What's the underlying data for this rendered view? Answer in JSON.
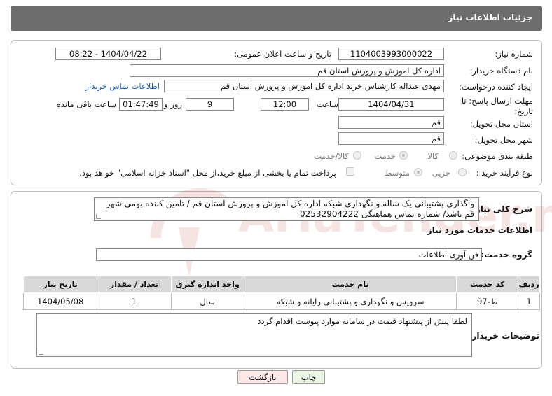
{
  "header": {
    "title": "جزئیات اطلاعات نیاز"
  },
  "form": {
    "need_number_label": "شماره نیاز:",
    "need_number": "1104003993000022",
    "announce_label": "تاریخ و ساعت اعلان عمومی:",
    "announce_value": "1404/04/22 - 08:22",
    "buyer_org_label": "نام دستگاه خریدار:",
    "buyer_org": "اداره کل اموزش و پرورش استان قم",
    "creator_label": "ایجاد کننده درخواست:",
    "creator": "مهدی عیداله کارشناس خرید اداره کل اموزش و پرورش استان قم",
    "contact_link": "اطلاعات تماس خریدار",
    "deadline_label_1": "مهلت ارسال پاسخ: تا",
    "deadline_label_2": "تاریخ:",
    "deadline_date": "1404/04/31",
    "time_label": "ساعت",
    "deadline_time": "12:00",
    "days_value": "9",
    "days_label": "روز و",
    "remaining_time": "01:47:49",
    "remaining_label": "ساعت باقی مانده",
    "province_label": "استان محل تحویل:",
    "province": "قم",
    "city_label": "شهر محل تحویل:",
    "city": "قم",
    "category_label": "طبقه بندی موضوعی:",
    "category_options": [
      "کالا",
      "خدمت",
      "کالا/خدمت"
    ],
    "category_selected": "خدمت",
    "process_label": "نوع فرآیند خرید :",
    "process_options": [
      "جزیی",
      "متوسط"
    ],
    "process_selected": "متوسط",
    "payment_note": "پرداخت تمام یا بخشی از مبلغ خرید،از محل \"اسناد خزانه اسلامی\" خواهد بود."
  },
  "summary": {
    "label": "شرح کلی نیاز:",
    "text": "واگذاری پشتیبانی یک ساله و نگهداری شبکه اداره کل آموزش و پرورش استان قم / تامین کننده بومی شهر قم باشد/ شماره تماس هماهنگی 02532904222"
  },
  "services": {
    "section_title": "اطلاعات خدمات مورد نیاز",
    "group_label": "گروه خدمت:",
    "group_value": "فن آوری اطلاعات",
    "columns": [
      "ردیف",
      "کد خدمت",
      "نام خدمت",
      "واحد اندازه گیری",
      "تعداد / مقدار",
      "تاریخ نیاز"
    ],
    "rows": [
      [
        "1",
        "ط-97",
        "سرویس و نگهداری و پشتیبانی رایانه و شبکه",
        "سال",
        "1",
        "1404/05/08"
      ]
    ]
  },
  "notes": {
    "label": "توضیحات خریدار:",
    "text": "لطفا پیش از پیشنهاد قیمت در سامانه موارد پیوست اقدام گردد"
  },
  "buttons": {
    "print": "چاپ",
    "back": "بازگشت"
  },
  "watermark": {
    "text": "AriaTender.net"
  },
  "colors": {
    "title_bar": "#6d6d6d",
    "link": "#1a5fb4",
    "back_button": "#fde8e8",
    "print_button": "#eaf5e4",
    "watermark": "#c0392b"
  }
}
